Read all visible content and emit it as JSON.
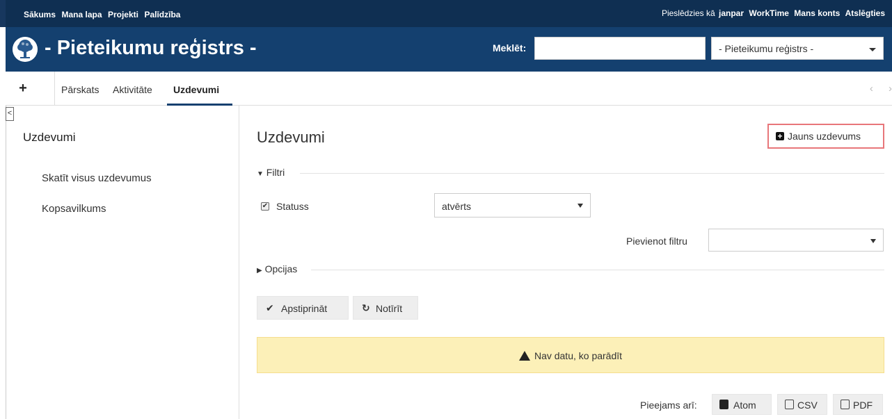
{
  "top_menu": {
    "left": [
      "Sākums",
      "Mana lapa",
      "Projekti",
      "Palīdzība"
    ],
    "logged_in_prefix": "Pieslēdzies kā",
    "user": "janpar",
    "right": [
      "WorkTime",
      "Mans konts",
      "Atslēgties"
    ]
  },
  "header": {
    "title": "- Pieteikumu reģistrs -",
    "search_label": "Meklēt:",
    "search_value": "",
    "project_select": "- Pieteikumu reģistrs -"
  },
  "tabs": {
    "new": "+",
    "items": [
      "Pārskats",
      "Aktivitāte",
      "Uzdevumi"
    ],
    "selected": "Uzdevumi",
    "scroll_left": "‹",
    "scroll_right": "›"
  },
  "sidebar": {
    "toggle": "<",
    "title": "Uzdevumi",
    "links": [
      "Skatīt visus uzdevumus",
      "Kopsavilkums"
    ]
  },
  "content": {
    "title": "Uzdevumi",
    "new_issue": "Jauns uzdevums",
    "filters_legend": "Filtri",
    "status_label": "Statuss",
    "status_checked": true,
    "status_value": "atvērts",
    "add_filter_label": "Pievienot filtru",
    "add_filter_value": "",
    "options_legend": "Opcijas",
    "apply": "Apstiprināt",
    "clear": "Notīrīt",
    "no_data": "Nav datu, ko parādīt",
    "also_available": "Pieejams arī:",
    "formats": [
      "Atom",
      "CSV",
      "PDF"
    ]
  },
  "colors": {
    "top_bar": "#0f2f52",
    "header": "#14406f",
    "warning_bg": "#fcf0b8",
    "highlight_border": "#e8767a"
  }
}
